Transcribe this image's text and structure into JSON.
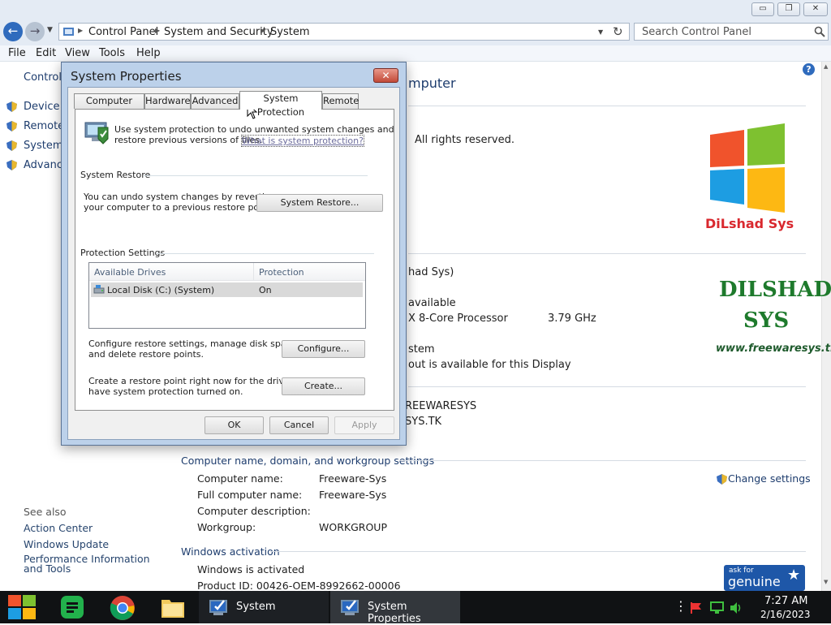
{
  "window": {
    "controls": {
      "minimize": "▭",
      "maximize": "❐",
      "close": "✕"
    }
  },
  "address": {
    "crumbs": [
      "Control Panel",
      "System and Security",
      "System"
    ],
    "search_placeholder": "Search Control Panel"
  },
  "menubar": {
    "items": [
      "File",
      "Edit",
      "View",
      "Tools",
      "Help"
    ]
  },
  "left_pane": {
    "home": "Control P",
    "links": [
      "Device M",
      "Remote",
      "System",
      "Advance"
    ],
    "see_also": "See also",
    "see_also_links": [
      "Action Center",
      "Windows Update",
      "Performance Information and Tools"
    ]
  },
  "main": {
    "header_partial": "mputer",
    "rights": "All rights reserved.",
    "edition_partial": "had Sys)",
    "ram_partial": "available",
    "cpu_partial": "X 8-Core Processor",
    "cpu_speed": "3.79 GHz",
    "systype_partial": "stem",
    "pen_partial": "out is available for this Display",
    "support_partial1": "REEWARESYS",
    "support_partial2": "SYS.TK",
    "computer_section": "Computer name, domain, and workgroup settings",
    "computer_rows": [
      {
        "label": "Computer name:",
        "value": "Freeware-Sys"
      },
      {
        "label": "Full computer name:",
        "value": "Freeware-Sys"
      },
      {
        "label": "Computer description:",
        "value": ""
      },
      {
        "label": "Workgroup:",
        "value": "WORKGROUP"
      }
    ],
    "change_settings": "Change settings",
    "activation_section": "Windows activation",
    "activation_status": "Windows is activated",
    "product_id": "Product ID: 00426-OEM-8992662-00006",
    "logo1_text": "DiLshad Sys",
    "logo2_line1": "DILSHAD",
    "logo2_line2": "SYS",
    "logo2_url": "www.freewaresys.tk",
    "genuine_small": "ask for",
    "genuine_big": "genuine"
  },
  "dialog": {
    "title": "System Properties",
    "close": "✕",
    "tabs": [
      "Computer Name",
      "Hardware",
      "Advanced",
      "System Protection",
      "Remote"
    ],
    "active_tab": "System Protection",
    "intro_line1": "Use system protection to undo unwanted system changes and",
    "intro_line2": "restore previous versions of files.",
    "intro_link": "What is system protection?",
    "system_restore_group": "System Restore",
    "system_restore_text1": "You can undo system changes by reverting",
    "system_restore_text2": "your computer to a previous restore point.",
    "system_restore_button": "System Restore...",
    "protection_group": "Protection Settings",
    "drives_columns": [
      "Available Drives",
      "Protection"
    ],
    "drives": [
      {
        "name": "Local Disk (C:) (System)",
        "protection": "On"
      }
    ],
    "configure_text1": "Configure restore settings, manage disk space,",
    "configure_text2": "and delete restore points.",
    "configure_button": "Configure...",
    "create_text1": "Create a restore point right now for the drives that",
    "create_text2": "have system protection turned on.",
    "create_button": "Create...",
    "ok": "OK",
    "cancel": "Cancel",
    "apply": "Apply"
  },
  "taskbar": {
    "tasks": [
      "System",
      "System Properties"
    ],
    "time": "7:27 AM",
    "date": "2/16/2023"
  },
  "colors": {
    "accent": "#3c78c8",
    "taskbar": "#101214",
    "dialog_frame": "#bcd1ea"
  }
}
